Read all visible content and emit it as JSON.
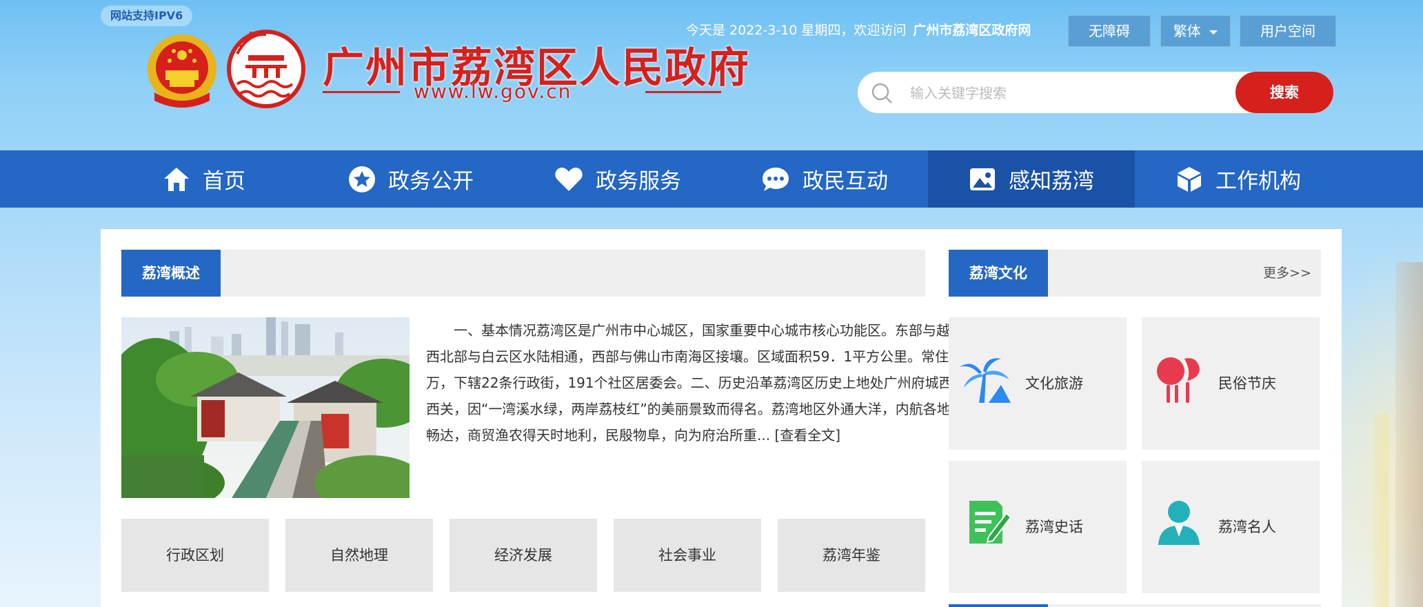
{
  "header": {
    "ipv6_badge": "网站支持IPV6",
    "site_name": "广州市荔湾区人民政府",
    "site_url": "www.lw.gov.cn",
    "date_text": "今天是 2022-3-10 星期四，欢迎访问",
    "welcome_site": "广州市荔湾区政府网",
    "buttons": {
      "accessibility": "无障碍",
      "traditional": "繁体",
      "user_space": "用户空间"
    },
    "search": {
      "placeholder": "输入关键字搜索",
      "button": "搜索"
    }
  },
  "nav": {
    "items": [
      {
        "label": "首页",
        "icon": "home-icon"
      },
      {
        "label": "政务公开",
        "icon": "star-icon"
      },
      {
        "label": "政务服务",
        "icon": "heart-icon"
      },
      {
        "label": "政民互动",
        "icon": "chat-icon"
      },
      {
        "label": "感知荔湾",
        "icon": "image-icon"
      },
      {
        "label": "工作机构",
        "icon": "cube-icon"
      }
    ],
    "active_index": 4
  },
  "overview": {
    "tab": "荔湾概述",
    "text": "一、基本情况荔湾区是广州市中心城区，国家重要中心城市核心功能区。东部与越秀区相连，西北部与白云区水陆相通，西部与佛山市南海区接壤。区域面积59．1平方公里。常住人口89．15万，下辖22条行政街，191个社区居委会。二、历史沿革荔湾区历史上地处广州府城西门外，俗称西关，因“一湾溪水绿，两岸荔枝红”的美丽景致而得名。荔湾地区外通大洋，内航各地，水陆交通畅达，商贸渔农得天时地利，民殷物阜，向为府治所重...",
    "read_more": "[查看全文]",
    "categories": [
      "行政区划",
      "自然地理",
      "经济发展",
      "社会事业",
      "荔湾年鉴"
    ]
  },
  "culture": {
    "tab": "荔湾文化",
    "more": "更多>>",
    "cards": [
      {
        "label": "文化旅游",
        "icon": "palm-tree-icon"
      },
      {
        "label": "民俗节庆",
        "icon": "lion-dance-icon"
      },
      {
        "label": "荔湾史话",
        "icon": "document-edit-icon"
      },
      {
        "label": "荔湾名人",
        "icon": "person-icon"
      }
    ]
  },
  "colors": {
    "nav_bg": "#2467c5",
    "nav_active": "#1a52a8",
    "search_button": "#d6201c",
    "brand_red": "#d6201c"
  }
}
